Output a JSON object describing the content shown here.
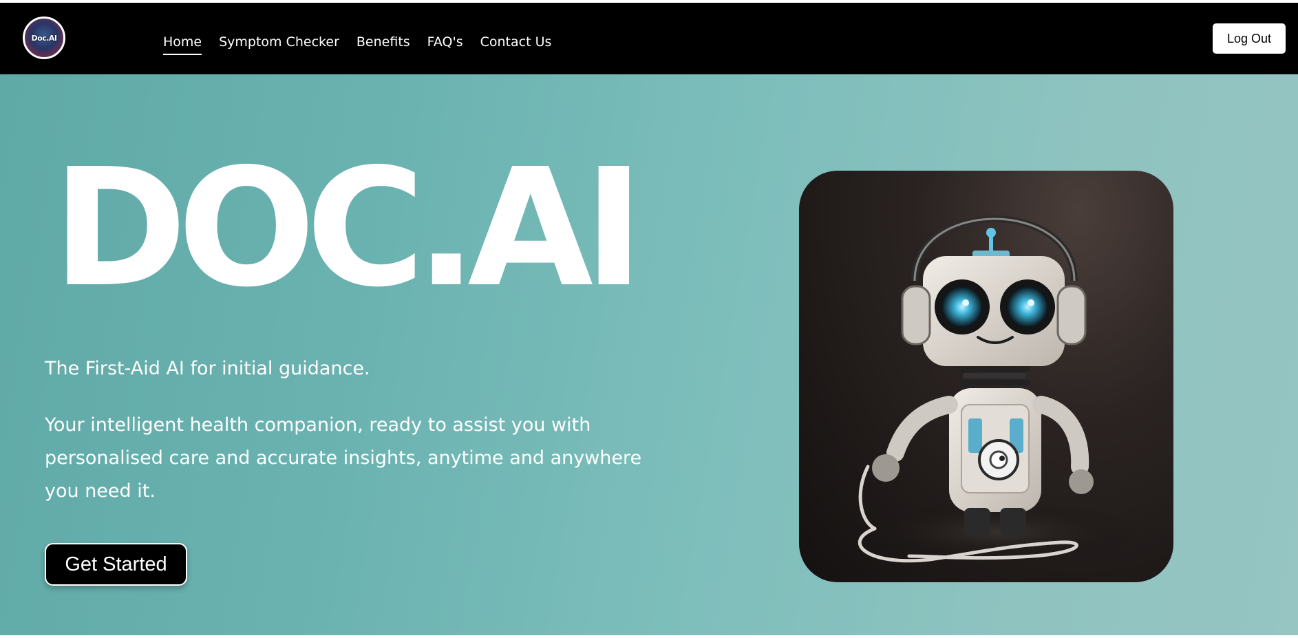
{
  "brand": {
    "logo_text": "Doc.AI"
  },
  "nav": {
    "items": [
      {
        "label": "Home",
        "active": true
      },
      {
        "label": "Symptom Checker",
        "active": false
      },
      {
        "label": "Benefits",
        "active": false
      },
      {
        "label": "FAQ's",
        "active": false
      },
      {
        "label": "Contact Us",
        "active": false
      }
    ],
    "logout_label": "Log Out"
  },
  "hero": {
    "title": "DOC.AI",
    "tagline": "The First-Aid AI for initial guidance.",
    "description": "Your intelligent health companion, ready to assist you with personalised care and accurate insights, anytime and anywhere you need it.",
    "cta_label": "Get Started",
    "image_subject": "robot-doctor-with-stethoscope"
  },
  "colors": {
    "navbar": "#000000",
    "hero_bg": "#6bb3b1",
    "text": "#ffffff",
    "cta_bg": "#000000",
    "robot_accent": "#5fc6e6"
  }
}
